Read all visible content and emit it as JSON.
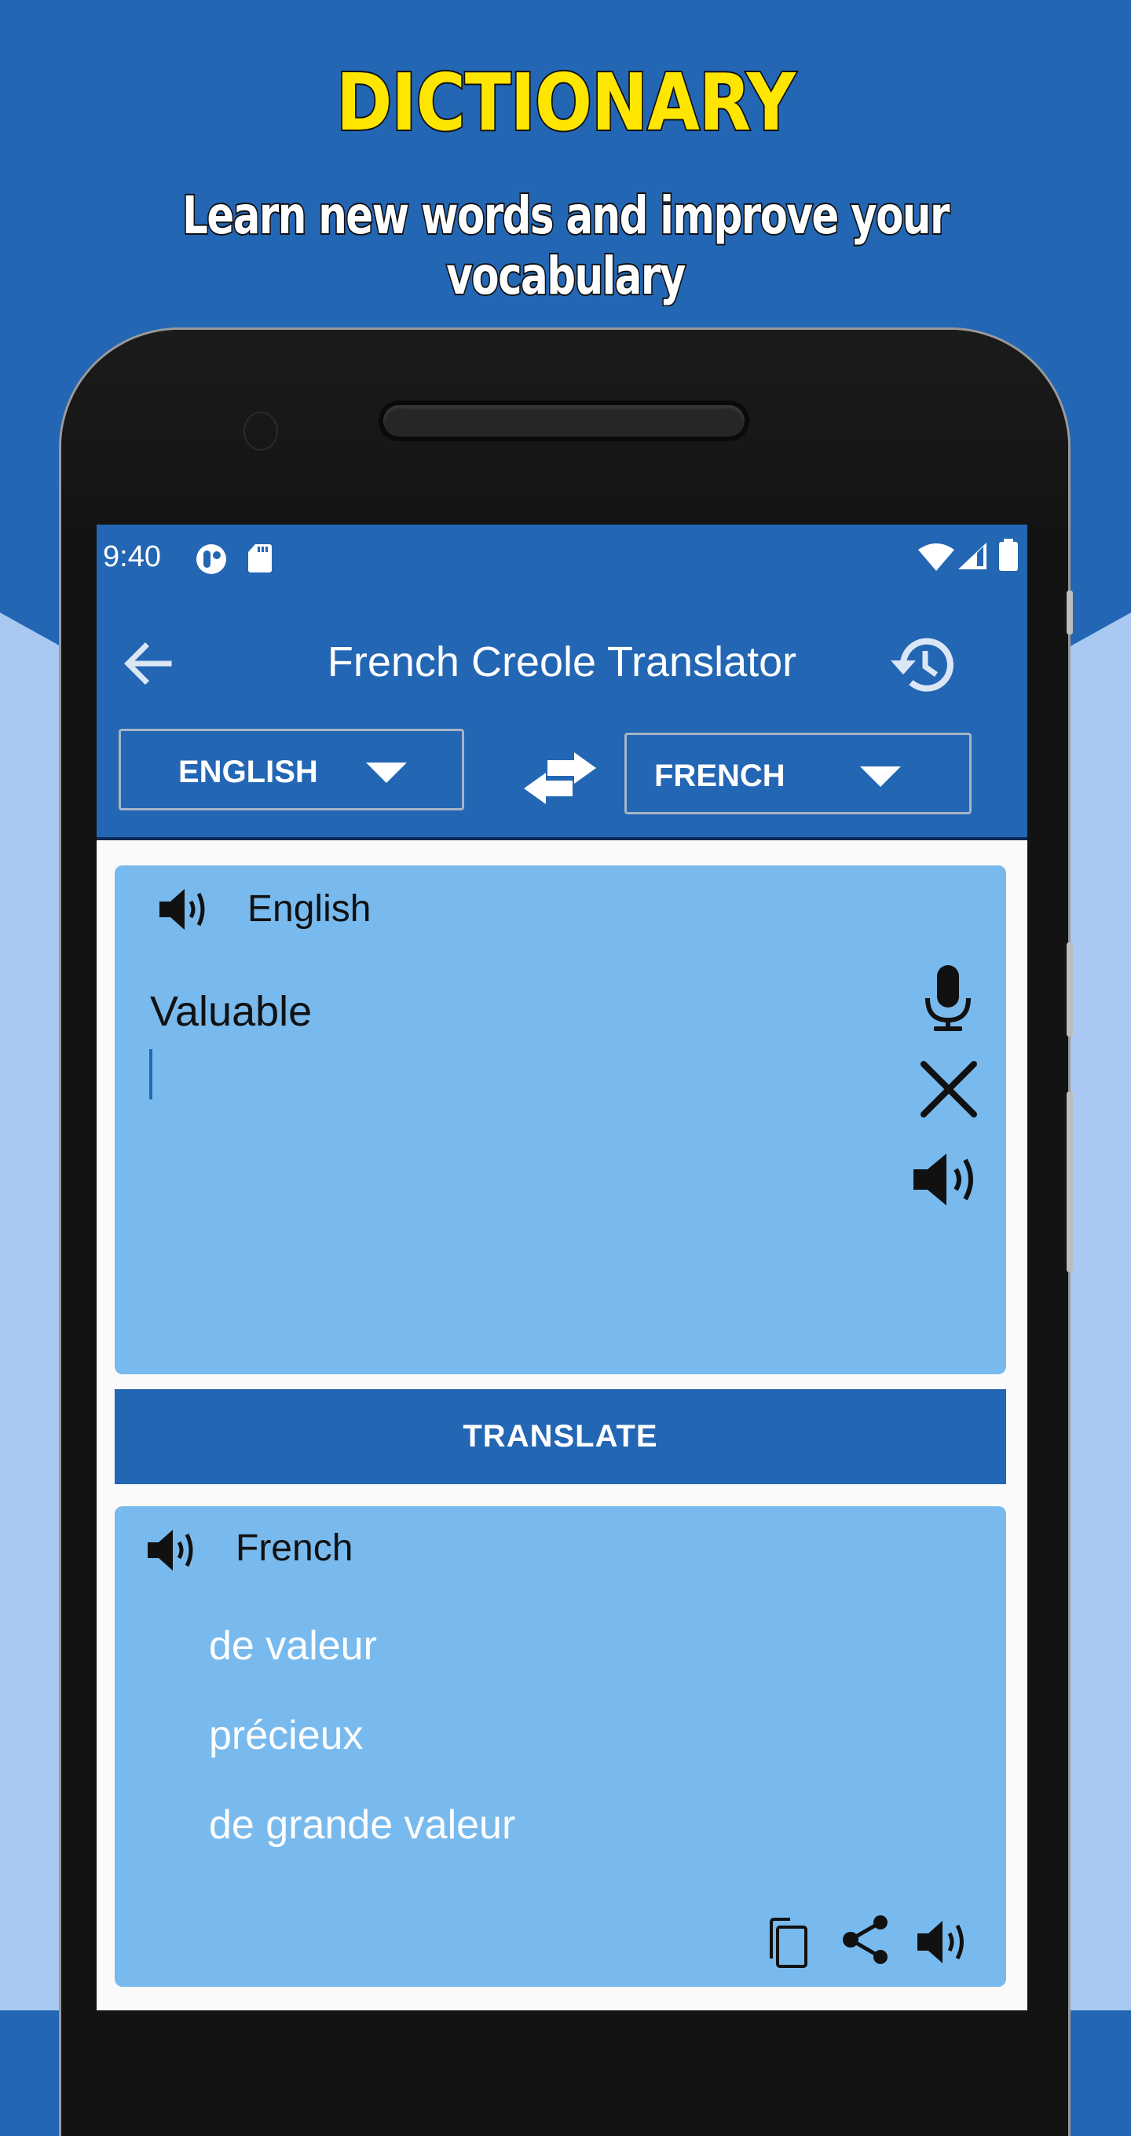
{
  "promo": {
    "title": "DICTIONARY",
    "subtitle": "Learn new words and improve your vocabulary"
  },
  "colors": {
    "background_dark": "#2366B4",
    "background_light": "#A9C9F2",
    "title_yellow": "#FFE600",
    "primary": "#2366B4",
    "card": "#78BAEE",
    "screen_bg": "#FAFAFA"
  },
  "status_bar": {
    "time": "9:40",
    "left_icons": [
      "assistant-app-icon",
      "sd-card-icon"
    ],
    "right_icons": [
      "wifi-icon",
      "cellular-signal-icon",
      "battery-icon"
    ]
  },
  "app_bar": {
    "title": "French Creole Translator",
    "back_icon": "arrow-left-icon",
    "history_icon": "history-icon"
  },
  "language_bar": {
    "source_language": "ENGLISH",
    "target_language": "FRENCH",
    "swap_icon": "swap-arrows-icon"
  },
  "input_card": {
    "language_label": "English",
    "input_value": "Valuable",
    "actions": [
      "microphone-icon",
      "clear-icon",
      "speaker-icon"
    ]
  },
  "translate_button": {
    "label": "TRANSLATE"
  },
  "output_card": {
    "language_label": "French",
    "results": [
      "de valeur",
      "précieux",
      "de grande valeur"
    ],
    "actions": [
      "copy-icon",
      "share-icon",
      "speaker-icon"
    ]
  }
}
